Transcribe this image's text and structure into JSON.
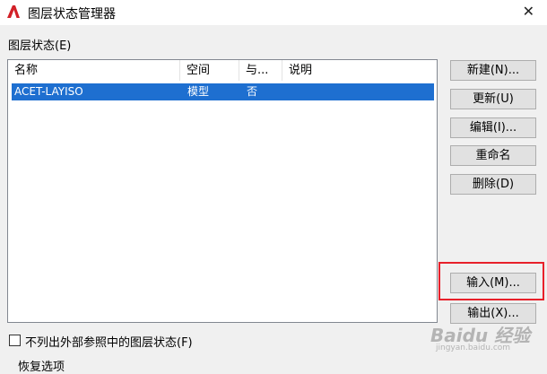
{
  "window": {
    "title": "图层状态管理器",
    "close_glyph": "✕"
  },
  "section_label": "图层状态(E)",
  "table": {
    "columns": [
      "名称",
      "空间",
      "与...",
      "说明"
    ],
    "rows": [
      {
        "name": "ACET-LAYISO",
        "space": "模型",
        "same": "否",
        "desc": ""
      }
    ]
  },
  "buttons": {
    "new": "新建(N)...",
    "update": "更新(U)",
    "edit": "编辑(I)...",
    "rename": "重命名",
    "delete": "删除(D)",
    "import": "输入(M)...",
    "export": "输出(X)..."
  },
  "checkbox_label": "不列出外部参照中的图层状态(F)",
  "restore_label": "恢复选项",
  "watermark": {
    "brand": "Baidu 经验",
    "url": "jingyan.baidu.com"
  },
  "colors": {
    "selection": "#1e6fd0",
    "highlight_box": "#e8202a",
    "app_icon": "#d22128"
  }
}
